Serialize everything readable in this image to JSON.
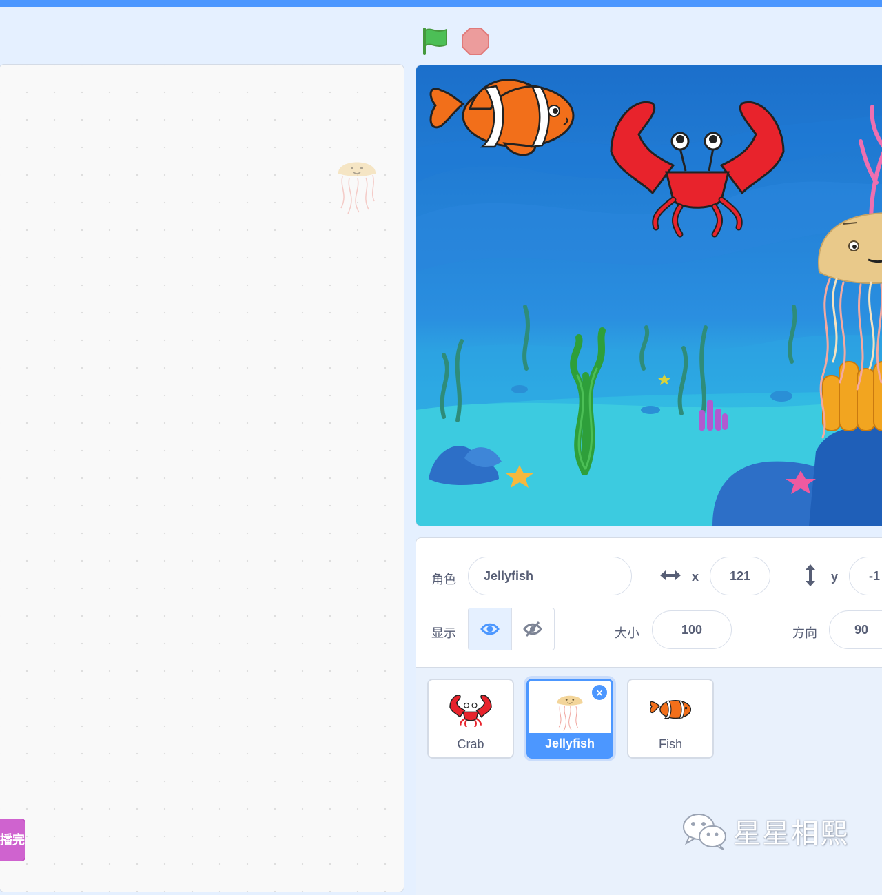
{
  "sprite_info": {
    "sprite_label": "角色",
    "sprite_name": "Jellyfish",
    "x_label": "x",
    "x_value": "121",
    "y_label": "y",
    "y_value": "-1",
    "show_label": "显示",
    "size_label": "大小",
    "size_value": "100",
    "direction_label": "方向",
    "direction_value": "90"
  },
  "workspace": {
    "block_text": "播完"
  },
  "sprites": [
    {
      "name": "Crab",
      "icon": "crab-icon"
    },
    {
      "name": "Jellyfish",
      "icon": "jellyfish-icon",
      "selected": true,
      "delete_glyph": "×"
    },
    {
      "name": "Fish",
      "icon": "clownfish-icon"
    }
  ],
  "watermark": {
    "text": "星星相熙",
    "icon": "wechat-icon"
  },
  "colors": {
    "accent": "#4c97ff",
    "block_sound": "#cf63cf",
    "flag": "#4cbf56",
    "stop": "#ec9c9c"
  }
}
